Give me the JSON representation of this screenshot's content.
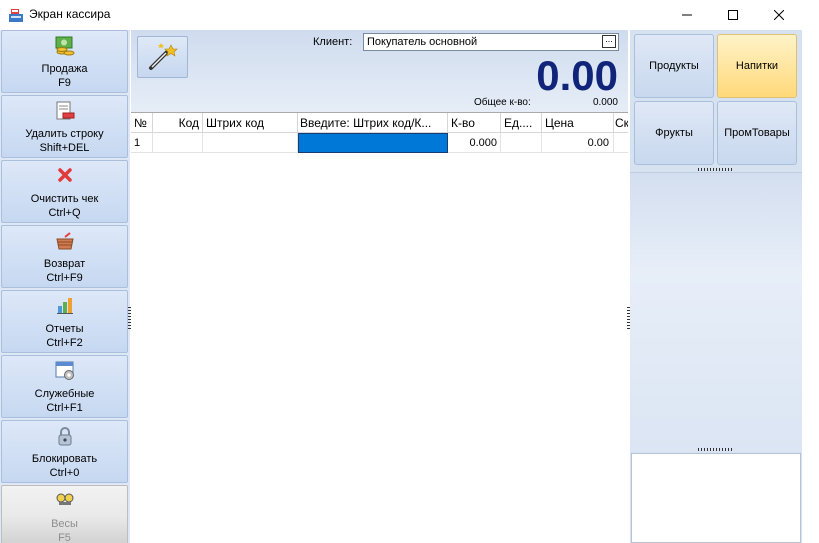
{
  "window": {
    "title": "Экран кассира",
    "icons": {
      "app": "cash-register-icon",
      "minimize": "minimize-icon",
      "maximize": "maximize-icon",
      "close": "close-icon"
    }
  },
  "left_menu": [
    {
      "label": "Продажа",
      "shortcut": "F9",
      "icon": "coins-icon",
      "enabled": true
    },
    {
      "label": "Удалить строку",
      "shortcut": "Shift+DEL",
      "icon": "delete-row-icon",
      "enabled": true
    },
    {
      "label": "Очистить чек",
      "shortcut": "Ctrl+Q",
      "icon": "clear-icon",
      "enabled": true
    },
    {
      "label": "Возврат",
      "shortcut": "Ctrl+F9",
      "icon": "return-icon",
      "enabled": true
    },
    {
      "label": "Отчеты",
      "shortcut": "Ctrl+F2",
      "icon": "chart-icon",
      "enabled": true
    },
    {
      "label": "Служебные",
      "shortcut": "Ctrl+F1",
      "icon": "settings-window-icon",
      "enabled": true
    },
    {
      "label": "Блокировать",
      "shortcut": "Ctrl+0",
      "icon": "lock-icon",
      "enabled": true
    },
    {
      "label": "Весы",
      "shortcut": "F5",
      "icon": "scales-icon",
      "enabled": false
    }
  ],
  "toolbar": {
    "wand_icon": "magic-wand-icon"
  },
  "client": {
    "label": "Клиент:",
    "value": "Покупатель основной",
    "browse_label": "..."
  },
  "totals": {
    "amount": "0.00",
    "qty_label": "Общее к-во:",
    "qty_value": "0.000"
  },
  "grid": {
    "columns": [
      "№",
      "Код",
      "Штрих код",
      "Введите: Штрих код/К...",
      "К-во",
      "Ед....",
      "Цена",
      "Ск"
    ],
    "rows": [
      {
        "num": "1",
        "code": "",
        "barcode": "",
        "input": "",
        "qty": "0.000",
        "unit": "",
        "price": "0.00",
        "discount": ""
      }
    ],
    "selection_color": "#0078d7"
  },
  "categories": [
    {
      "label": "Продукты",
      "active": false
    },
    {
      "label": "Напитки",
      "active": true
    },
    {
      "label": "Фрукты",
      "active": false
    },
    {
      "label": "ПромТовары",
      "active": false
    }
  ],
  "colors": {
    "total": "#10247a",
    "panel": "#dde7f5",
    "active_category": "#ffd97a"
  }
}
